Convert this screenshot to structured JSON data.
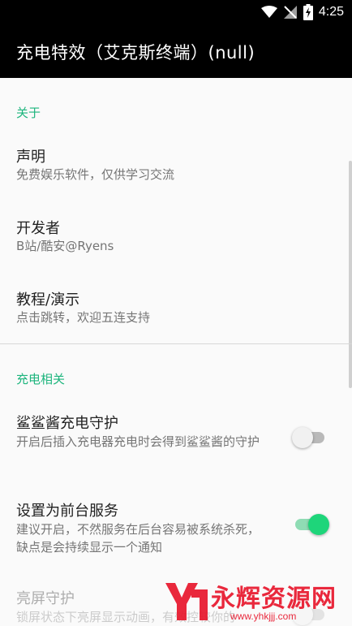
{
  "status_bar": {
    "time": "4:25"
  },
  "app_bar": {
    "title": "充电特效（艾克斯终端）(null)"
  },
  "sections": {
    "about": {
      "header": "关于",
      "items": [
        {
          "title": "声明",
          "summary": "免费娱乐软件，仅供学习交流"
        },
        {
          "title": "开发者",
          "summary": "B站/酷安@Ryens"
        },
        {
          "title": "教程/演示",
          "summary": "点击跳转，欢迎五连支持"
        }
      ]
    },
    "charging": {
      "header": "充电相关",
      "items": [
        {
          "title": "鲨鲨酱充电守护",
          "summary": "开启后插入充电器充电时会得到鲨鲨酱的守护",
          "switch_on": false
        },
        {
          "title": "设置为前台服务",
          "summary": "建议开启，不然服务在后台容易被系统杀死，缺点是会持续显示一个通知",
          "switch_on": true
        },
        {
          "title": "亮屏守护",
          "summary": "锁屏状态下亮屏显示动画，有效控较你的",
          "switch_on": false,
          "enabled": false
        }
      ]
    }
  },
  "watermark": {
    "brand": "永辉资源网",
    "url": "www.yhkjjj.com"
  },
  "colors": {
    "accent": "#1db57d",
    "switch_on": "#1ed57a",
    "appbar": "#000000",
    "watermark": "#e8172c"
  }
}
